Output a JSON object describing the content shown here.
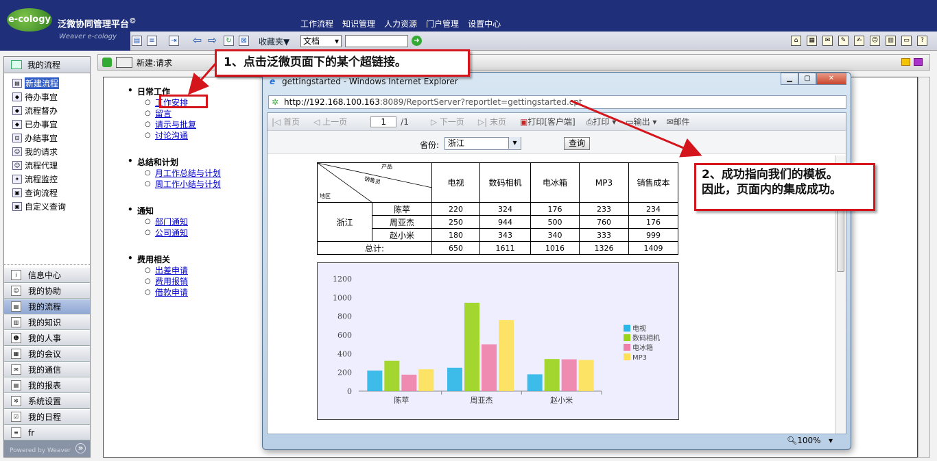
{
  "header": {
    "logo_text": "e-cology",
    "brand": "泛微协同管理平台",
    "brand_mark": "©",
    "brand_sub": "Weaver e-cology",
    "nav": [
      "工作流程",
      "知识管理",
      "人力资源",
      "门户管理",
      "设置中心"
    ]
  },
  "toolbar": {
    "favorites_label": "收藏夹▼",
    "doc_select": "文档",
    "search_value": ""
  },
  "left": {
    "title": "我的流程",
    "tree": [
      {
        "label": "新建流程",
        "icon": "form-icon",
        "selected": true
      },
      {
        "label": "待办事宜",
        "icon": "todo-icon"
      },
      {
        "label": "流程督办",
        "icon": "supervise-icon"
      },
      {
        "label": "已办事宜",
        "icon": "done-icon"
      },
      {
        "label": "办结事宜",
        "icon": "finished-icon"
      },
      {
        "label": "我的请求",
        "icon": "request-icon"
      },
      {
        "label": "流程代理",
        "icon": "agent-icon"
      },
      {
        "label": "流程监控",
        "icon": "monitor-icon"
      },
      {
        "label": "查询流程",
        "icon": "query-icon"
      },
      {
        "label": "自定义查询",
        "icon": "custom-query-icon"
      }
    ],
    "modules": [
      "信息中心",
      "我的协助",
      "我的流程",
      "我的知识",
      "我的人事",
      "我的会议",
      "我的通信",
      "我的报表",
      "系统设置",
      "我的日程",
      "fr"
    ],
    "active_module": "我的流程",
    "powered": "Powered by Weaver"
  },
  "main": {
    "title": "新建:请求",
    "sections": [
      {
        "heading": "日常工作",
        "links": [
          "工作安排",
          "留言",
          "请示与批复",
          "讨论沟通"
        ]
      },
      {
        "heading": "总结和计划",
        "links": [
          "月工作总结与计划",
          "周工作小结与计划"
        ]
      },
      {
        "heading": "通知",
        "links": [
          "部门通知",
          "公司通知"
        ]
      },
      {
        "heading": "费用相关",
        "links": [
          "出差申请",
          "费用报销",
          "借款申请"
        ]
      }
    ]
  },
  "ie": {
    "title": "gettingstarted - Windows Internet Explorer",
    "url_host": "http://192.168.100.163",
    "url_path": ":8089/ReportServer?reportlet=gettingstarted.cpt",
    "toolbar": {
      "first": "首页",
      "prev": "上一页",
      "page": "1",
      "total": "/1",
      "next": "下一页",
      "last": "末页",
      "print_client": "打印[客户端]",
      "print": "打印",
      "export": "输出",
      "mail": "邮件"
    },
    "param_label": "省份:",
    "param_value": "浙江",
    "query_button": "查询",
    "zoom": "100%"
  },
  "table": {
    "corner_labels": [
      "产品",
      "销售员",
      "地区"
    ],
    "columns": [
      "电视",
      "数码相机",
      "电冰箱",
      "MP3",
      "销售成本"
    ],
    "region": "浙江",
    "rows": [
      {
        "name": "陈苹",
        "values": [
          "220",
          "324",
          "176",
          "233",
          "234"
        ]
      },
      {
        "name": "周亚杰",
        "values": [
          "250",
          "944",
          "500",
          "760",
          "176"
        ]
      },
      {
        "name": "赵小米",
        "values": [
          "180",
          "343",
          "340",
          "333",
          "999"
        ]
      }
    ],
    "total_label": "总计:",
    "totals": [
      "650",
      "1611",
      "1016",
      "1326",
      "1409"
    ]
  },
  "chart_data": {
    "type": "bar",
    "categories": [
      "陈苹",
      "周亚杰",
      "赵小米"
    ],
    "series": [
      {
        "name": "电视",
        "values": [
          220,
          250,
          180
        ],
        "color": "#29b6e8"
      },
      {
        "name": "数码相机",
        "values": [
          324,
          944,
          343
        ],
        "color": "#9ad41a"
      },
      {
        "name": "电冰箱",
        "values": [
          176,
          500,
          340
        ],
        "color": "#ee7fa8"
      },
      {
        "name": "MP3",
        "values": [
          233,
          760,
          333
        ],
        "color": "#fde054"
      }
    ],
    "yticks": [
      0,
      200,
      400,
      600,
      800,
      1000,
      1200
    ],
    "ylim": [
      0,
      1200
    ],
    "legend": "right",
    "title": "",
    "xlabel": "",
    "ylabel": ""
  },
  "annotations": {
    "step1": "1、点击泛微页面下的某个超链接。",
    "step2_line1": "2、成功指向我们的模板。",
    "step2_line2": "因此，页面内的集成成功。",
    "accent": "#d4151b"
  }
}
